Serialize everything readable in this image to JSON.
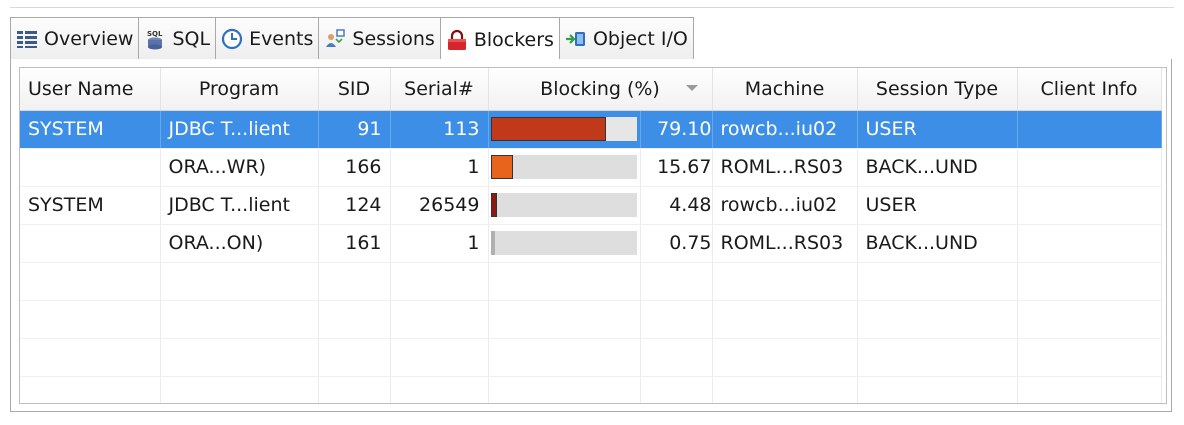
{
  "tabs": [
    {
      "label": "Overview",
      "icon": "overview-icon"
    },
    {
      "label": "SQL",
      "icon": "sql-icon"
    },
    {
      "label": "Events",
      "icon": "clock-icon"
    },
    {
      "label": "Sessions",
      "icon": "sessions-icon"
    },
    {
      "label": "Blockers",
      "icon": "lock-icon",
      "active": true
    },
    {
      "label": "Object I/O",
      "icon": "object-io-icon"
    }
  ],
  "table": {
    "columns": [
      "User Name",
      "Program",
      "SID",
      "Serial#",
      "Blocking (%)",
      "",
      "Machine",
      "Session Type",
      "Client Info"
    ],
    "sorted_column": "Blocking (%)",
    "rows": [
      {
        "user": "SYSTEM",
        "program": "JDBC T...lient",
        "sid": "91",
        "serial": "113",
        "blocking_pct": "79.10",
        "blocking": 79.1,
        "bar_color": "#c0391b",
        "machine": "rowcb...iu02",
        "session_type": "USER",
        "client_info": "",
        "selected": true
      },
      {
        "user": "",
        "program": "ORA...WR)",
        "sid": "166",
        "serial": "1",
        "blocking_pct": "15.67",
        "blocking": 15.67,
        "bar_color": "#e8641c",
        "machine": "ROML...RS03",
        "session_type": "BACK...UND",
        "client_info": ""
      },
      {
        "user": "SYSTEM",
        "program": "JDBC T...lient",
        "sid": "124",
        "serial": "26549",
        "blocking_pct": "4.48",
        "blocking": 4.48,
        "bar_color": "#8b1a12",
        "machine": "rowcb...iu02",
        "session_type": "USER",
        "client_info": ""
      },
      {
        "user": "",
        "program": "ORA...ON)",
        "sid": "161",
        "serial": "1",
        "blocking_pct": "0.75",
        "blocking": 0.75,
        "bar_color": "#b0b0b0",
        "machine": "ROML...RS03",
        "session_type": "BACK...UND",
        "client_info": ""
      }
    ]
  }
}
